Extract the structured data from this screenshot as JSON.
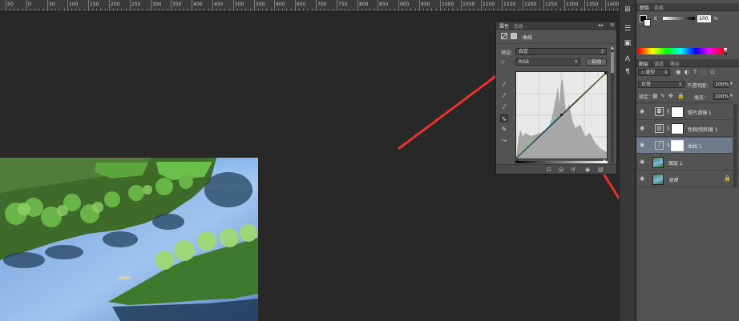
{
  "ruler": {
    "labels": [
      "50",
      "0",
      "50",
      "100",
      "150",
      "200",
      "250",
      "300",
      "350",
      "400",
      "450",
      "500",
      "550",
      "600",
      "650",
      "700",
      "750",
      "800",
      "850",
      "900",
      "950",
      "1000",
      "1050",
      "1100",
      "1150",
      "1200",
      "1250",
      "1300",
      "1350",
      "1400"
    ]
  },
  "properties_panel": {
    "tab_properties": "属性",
    "tab_info": "信息",
    "adjustment_title": "曲线",
    "preset_label": "预设：",
    "preset_value": "自定",
    "channel_value": "RGB",
    "auto_button": "自动",
    "collapse_glyph": "◂◂",
    "menu_glyph": "≡"
  },
  "color_panel": {
    "tab_color": "颜色",
    "tab_swatches": "色板",
    "slider_label": "K",
    "slider_value": "100",
    "slider_unit": "%"
  },
  "layers_panel": {
    "tab_layers": "图层",
    "tab_channels": "通道",
    "tab_paths": "路径",
    "filter_kind": "类型",
    "blend_mode": "正常",
    "opacity_label": "不透明度：",
    "opacity_value": "100%",
    "lock_label": "锁定：",
    "fill_label": "填充：",
    "fill_value": "100%",
    "layers": [
      {
        "name": "照片滤镜 1"
      },
      {
        "name": "色相/饱和度 1"
      },
      {
        "name": "曲线 1"
      },
      {
        "name": "图层 1"
      },
      {
        "name": "背景"
      }
    ]
  },
  "colors": {
    "annotation_arrow": "#e8322e",
    "selected_layer": "#6f7b8c",
    "panel_bg": "#535353"
  }
}
